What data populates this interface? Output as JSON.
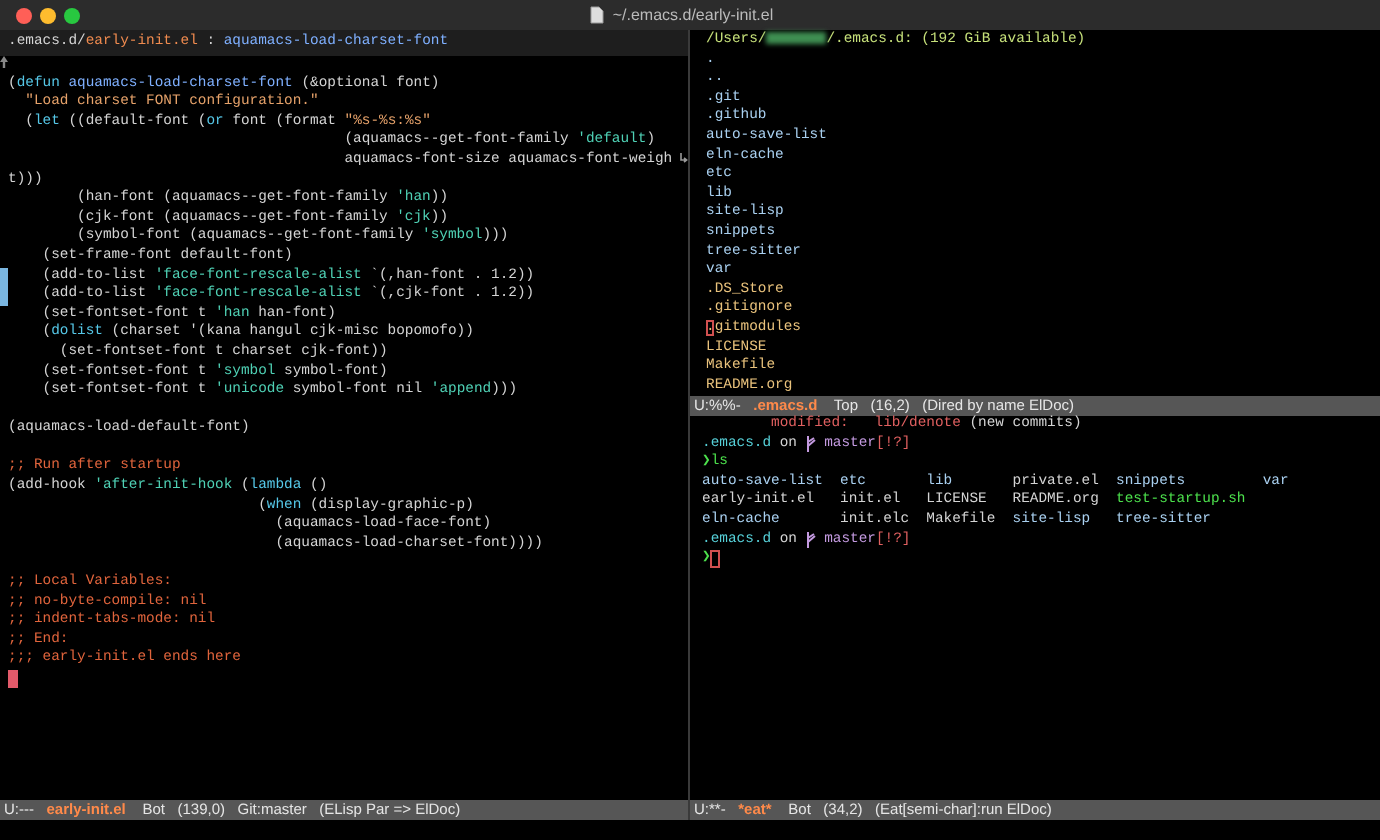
{
  "window": {
    "title": "~/.emacs.d/early-init.el"
  },
  "left_pane": {
    "header": [
      {
        "text": ".emacs.d/",
        "kind": "plain"
      },
      {
        "text": "early-init.el",
        "kind": "buffer"
      },
      {
        "text": " : ",
        "kind": "plain"
      },
      {
        "text": "aquamacs-load-charset-font",
        "kind": "fn"
      }
    ],
    "lines": [
      {
        "changed": false,
        "segments": [
          {
            "text": "(",
            "kind": "plain"
          },
          {
            "text": "defun",
            "kind": "keyword"
          },
          {
            "text": " aquamacs-load-charset-font",
            "kind": "fn"
          },
          {
            "text": " (&optional font)",
            "kind": "plain"
          }
        ]
      },
      {
        "changed": false,
        "segments": [
          {
            "text": "  \"Load charset FONT configuration.\"",
            "kind": "string"
          }
        ]
      },
      {
        "changed": false,
        "segments": [
          {
            "text": "  (",
            "kind": "plain"
          },
          {
            "text": "let",
            "kind": "keyword"
          },
          {
            "text": " ((default-font (",
            "kind": "plain"
          },
          {
            "text": "or",
            "kind": "keyword"
          },
          {
            "text": " font (format ",
            "kind": "plain"
          },
          {
            "text": "\"%s-%s:%s\"",
            "kind": "string"
          }
        ]
      },
      {
        "changed": false,
        "segments": [
          {
            "text": "                                       (aquamacs--get-font-family ",
            "kind": "plain"
          },
          {
            "text": "'default",
            "kind": "quote"
          },
          {
            "text": ")",
            "kind": "plain"
          }
        ]
      },
      {
        "changed": false,
        "wrapped": true,
        "segments": [
          {
            "text": "                                       aquamacs-font-size aquamacs-font-weigh",
            "kind": "plain"
          }
        ]
      },
      {
        "changed": false,
        "segments": [
          {
            "text": "t)))",
            "kind": "plain"
          }
        ]
      },
      {
        "changed": false,
        "segments": [
          {
            "text": "        (han-font (aquamacs--get-font-family ",
            "kind": "plain"
          },
          {
            "text": "'han",
            "kind": "quote"
          },
          {
            "text": "))",
            "kind": "plain"
          }
        ]
      },
      {
        "changed": false,
        "segments": [
          {
            "text": "        (cjk-font (aquamacs--get-font-family ",
            "kind": "plain"
          },
          {
            "text": "'cjk",
            "kind": "quote"
          },
          {
            "text": "))",
            "kind": "plain"
          }
        ]
      },
      {
        "changed": false,
        "segments": [
          {
            "text": "        (symbol-font (aquamacs--get-font-family ",
            "kind": "plain"
          },
          {
            "text": "'symbol",
            "kind": "quote"
          },
          {
            "text": ")))",
            "kind": "plain"
          }
        ]
      },
      {
        "changed": false,
        "segments": [
          {
            "text": "    (set-frame-font default-font)",
            "kind": "plain"
          }
        ]
      },
      {
        "changed": true,
        "segments": [
          {
            "text": "    (add-to-list ",
            "kind": "plain"
          },
          {
            "text": "'face-font-rescale-alist",
            "kind": "quote"
          },
          {
            "text": " `(,han-font . 1.2))",
            "kind": "plain"
          }
        ]
      },
      {
        "changed": true,
        "segments": [
          {
            "text": "    (add-to-list ",
            "kind": "plain"
          },
          {
            "text": "'face-font-rescale-alist",
            "kind": "quote"
          },
          {
            "text": " `(,cjk-font . 1.2))",
            "kind": "plain"
          }
        ]
      },
      {
        "changed": false,
        "segments": [
          {
            "text": "    (set-fontset-font t ",
            "kind": "plain"
          },
          {
            "text": "'han",
            "kind": "quote"
          },
          {
            "text": " han-font)",
            "kind": "plain"
          }
        ]
      },
      {
        "changed": false,
        "segments": [
          {
            "text": "    (",
            "kind": "plain"
          },
          {
            "text": "dolist",
            "kind": "keyword"
          },
          {
            "text": " (charset '(kana hangul cjk-misc bopomofo))",
            "kind": "plain"
          }
        ]
      },
      {
        "changed": false,
        "segments": [
          {
            "text": "      (set-fontset-font t charset cjk-font))",
            "kind": "plain"
          }
        ]
      },
      {
        "changed": false,
        "segments": [
          {
            "text": "    (set-fontset-font t ",
            "kind": "plain"
          },
          {
            "text": "'symbol",
            "kind": "quote"
          },
          {
            "text": " symbol-font)",
            "kind": "plain"
          }
        ]
      },
      {
        "changed": false,
        "segments": [
          {
            "text": "    (set-fontset-font t ",
            "kind": "plain"
          },
          {
            "text": "'unicode",
            "kind": "quote"
          },
          {
            "text": " symbol-font nil ",
            "kind": "plain"
          },
          {
            "text": "'append",
            "kind": "quote"
          },
          {
            "text": ")))",
            "kind": "plain"
          }
        ]
      },
      {
        "changed": false
      },
      {
        "changed": false,
        "segments": [
          {
            "text": "(aquamacs-load-default-font)",
            "kind": "plain"
          }
        ]
      },
      {
        "changed": false
      },
      {
        "changed": false,
        "segments": [
          {
            "text": ";; Run after startup",
            "kind": "comment"
          }
        ]
      },
      {
        "changed": false,
        "segments": [
          {
            "text": "(add-hook ",
            "kind": "plain"
          },
          {
            "text": "'after-init-hook",
            "kind": "quote"
          },
          {
            "text": " (",
            "kind": "plain"
          },
          {
            "text": "lambda",
            "kind": "keyword"
          },
          {
            "text": " ()",
            "kind": "plain"
          }
        ]
      },
      {
        "changed": false,
        "segments": [
          {
            "text": "                             (",
            "kind": "plain"
          },
          {
            "text": "when",
            "kind": "keyword"
          },
          {
            "text": " (display-graphic-p)",
            "kind": "plain"
          }
        ]
      },
      {
        "changed": false,
        "segments": [
          {
            "text": "                               (aquamacs-load-face-font)",
            "kind": "plain"
          }
        ]
      },
      {
        "changed": false,
        "segments": [
          {
            "text": "                               (aquamacs-load-charset-font))))",
            "kind": "plain"
          }
        ]
      },
      {
        "changed": false
      },
      {
        "changed": false,
        "segments": [
          {
            "text": ";; Local Variables:",
            "kind": "comment"
          }
        ]
      },
      {
        "changed": false,
        "segments": [
          {
            "text": ";; no-byte-compile: nil",
            "kind": "comment"
          }
        ]
      },
      {
        "changed": false,
        "segments": [
          {
            "text": ";; indent-tabs-mode: nil",
            "kind": "comment"
          }
        ]
      },
      {
        "changed": false,
        "segments": [
          {
            "text": ";; End:",
            "kind": "comment"
          }
        ]
      },
      {
        "changed": false,
        "segments": [
          {
            "text": ";;; early-init.el ends here",
            "kind": "comment"
          }
        ]
      }
    ],
    "mode_line": {
      "state": "U:---",
      "buffer": "early-init.el",
      "position": "Bot",
      "line_col": "(139,0)",
      "vc": "Git:master",
      "modes": "(ELisp Par => ElDoc)"
    }
  },
  "dired_pane": {
    "header_prefix": "/Users/",
    "header_suffix": "/.emacs.d: (192 GiB available)",
    "items": [
      {
        "name": ".",
        "kind": "dir",
        "cursor": false
      },
      {
        "name": "..",
        "kind": "dir",
        "cursor": false
      },
      {
        "name": ".git",
        "kind": "dir",
        "cursor": false
      },
      {
        "name": ".github",
        "kind": "dir",
        "cursor": false
      },
      {
        "name": "auto-save-list",
        "kind": "dir",
        "cursor": false
      },
      {
        "name": "eln-cache",
        "kind": "dir",
        "cursor": false
      },
      {
        "name": "etc",
        "kind": "dir",
        "cursor": false
      },
      {
        "name": "lib",
        "kind": "dir",
        "cursor": false
      },
      {
        "name": "site-lisp",
        "kind": "dir",
        "cursor": false
      },
      {
        "name": "snippets",
        "kind": "dir",
        "cursor": false
      },
      {
        "name": "tree-sitter",
        "kind": "dir",
        "cursor": false
      },
      {
        "name": "var",
        "kind": "dir",
        "cursor": false
      },
      {
        "name": ".DS_Store",
        "kind": "file",
        "cursor": false
      },
      {
        "name": ".gitignore",
        "kind": "file",
        "cursor": false
      },
      {
        "name": ".gitmodules",
        "kind": "file",
        "cursor": true
      },
      {
        "name": "LICENSE",
        "kind": "file",
        "cursor": false
      },
      {
        "name": "Makefile",
        "kind": "file",
        "cursor": false
      },
      {
        "name": "README.org",
        "kind": "file",
        "cursor": false
      }
    ],
    "mode_line": {
      "state": "U:%%-",
      "buffer": ".emacs.d",
      "position": "Top",
      "line_col": "(16,2)",
      "modes": "(Dired by name ElDoc)"
    }
  },
  "terminal_pane": {
    "status_line": [
      {
        "text": "        modified:",
        "kind": "red"
      },
      {
        "text": "   lib/denote",
        "kind": "red"
      },
      {
        "text": " (new commits)",
        "kind": "plain"
      }
    ],
    "prompts": [
      {
        "dir": ".emacs.d",
        "on": " on ",
        "branch": "master",
        "status": "[!?]",
        "chevron": "❯",
        "command": "ls"
      },
      {
        "dir": ".emacs.d",
        "on": " on ",
        "branch": "master",
        "status": "[!?]",
        "chevron": "❯"
      }
    ],
    "ls_rows": [
      [
        {
          "text": "auto-save-list",
          "kind": "dir"
        },
        {
          "text": "etc",
          "kind": "dir"
        },
        {
          "text": "lib",
          "kind": "dir"
        },
        {
          "text": "private.el",
          "kind": "file"
        },
        {
          "text": "snippets",
          "kind": "dir"
        },
        {
          "text": "var",
          "kind": "dir"
        }
      ],
      [
        {
          "text": "early-init.el",
          "kind": "file"
        },
        {
          "text": "init.el",
          "kind": "file"
        },
        {
          "text": "LICENSE",
          "kind": "file"
        },
        {
          "text": "README.org",
          "kind": "file"
        },
        {
          "text": "test-startup.sh",
          "kind": "exec"
        }
      ],
      [
        {
          "text": "eln-cache",
          "kind": "dir"
        },
        {
          "text": "init.elc",
          "kind": "file"
        },
        {
          "text": "Makefile",
          "kind": "file"
        },
        {
          "text": "site-lisp",
          "kind": "dir"
        },
        {
          "text": "tree-sitter",
          "kind": "dir"
        }
      ]
    ],
    "mode_line": {
      "state": "U:**-",
      "buffer": "*eat*",
      "position": "Bot",
      "line_col": "(34,2)",
      "modes": "(Eat[semi-char]:run ElDoc)"
    }
  }
}
